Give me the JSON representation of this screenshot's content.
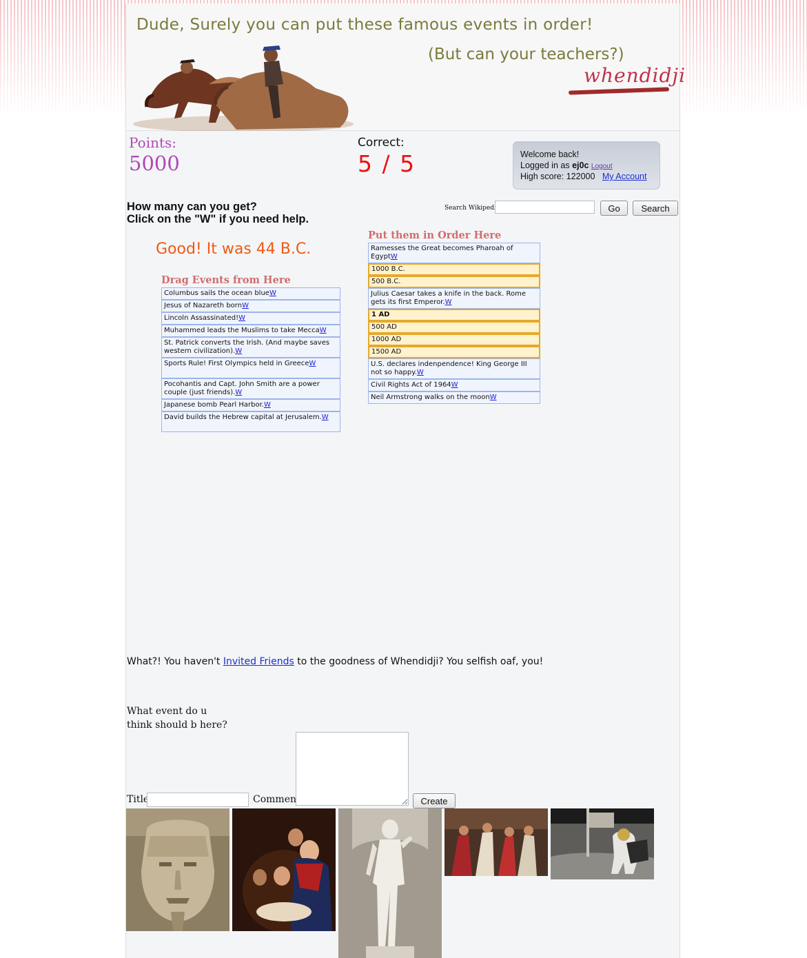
{
  "header": {
    "tagline": "Dude, Surely you can put these famous events in order!",
    "subtagline": "(But can your teachers?)",
    "logo": "whendidji"
  },
  "score": {
    "points_label": "Points:",
    "points_value": "5000",
    "correct_label": "Correct:",
    "correct_value": "5 / 5"
  },
  "account": {
    "welcome": "Welcome back!",
    "logged_in_prefix": "Logged in as",
    "username": "ej0c",
    "logout": "Logout",
    "high_score_label": "High score:",
    "high_score": "122000",
    "my_account": "My Account"
  },
  "prompt": {
    "line1": "How many can you get?",
    "line2": "Click on the \"W\" if you need help."
  },
  "search": {
    "label": "Search Wikipedia",
    "value": "",
    "go": "Go",
    "search": "Search"
  },
  "feedback": "Good! It was 44 B.C.",
  "drag_list": {
    "title": "Drag Events from Here",
    "items": [
      {
        "text": "Columbus sails the ocean blue",
        "w": "W"
      },
      {
        "text": "Jesus of Nazareth born",
        "w": "W"
      },
      {
        "text": "Lincoln Assassinated!",
        "w": "W"
      },
      {
        "text": "Muhammed leads the Muslims to take Mecca",
        "w": "W"
      },
      {
        "text": "St. Patrick converts the Irish. (And maybe saves western civilization).",
        "w": "W"
      },
      {
        "text": "Sports Rule! First Olympics held in Greece",
        "w": "W"
      },
      {
        "text": "Pocohantis and Capt. John Smith are a power couple (just friends).",
        "w": "W"
      },
      {
        "text": "Japanese bomb Pearl Harbor.",
        "w": "W"
      },
      {
        "text": "David builds the Hebrew capital at Jerusalem.",
        "w": "W"
      }
    ]
  },
  "order_list": {
    "title": "Put them in Order Here",
    "items": [
      {
        "text": "Ramesses the Great becomes Pharoah of Egypt",
        "w": "W",
        "kind": "event"
      },
      {
        "text": "1000 B.C.",
        "w": "",
        "kind": "slot"
      },
      {
        "text": "500 B.C.",
        "w": "",
        "kind": "slot"
      },
      {
        "text": "Julius Caesar takes a knife in the back. Rome gets its first Emperor.",
        "w": "W",
        "kind": "event"
      },
      {
        "text": "1 AD",
        "w": "",
        "kind": "slot-current"
      },
      {
        "text": "500 AD",
        "w": "",
        "kind": "slot"
      },
      {
        "text": "1000 AD",
        "w": "",
        "kind": "slot"
      },
      {
        "text": "1500 AD",
        "w": "",
        "kind": "slot"
      },
      {
        "text": "U.S. declares indenpendence! King George III not so happy.",
        "w": "W",
        "kind": "event"
      },
      {
        "text": "Civil Rights Act of 1964",
        "w": "W",
        "kind": "event"
      },
      {
        "text": "Neil Armstrong walks on the moon",
        "w": "W",
        "kind": "event"
      }
    ]
  },
  "invite": {
    "before": "What?! You haven't ",
    "link": "Invited Friends",
    "after": " to the goodness of Whendidji? You selfish oaf, you!"
  },
  "suggest": {
    "question": "What event do u think should b here?",
    "title_label": "Title",
    "title_value": "",
    "comment_label": "Comment",
    "comment_value": "",
    "create": "Create"
  },
  "thumbnails": [
    {
      "name": "ramesses-statue-image"
    },
    {
      "name": "nativity-painting-image"
    },
    {
      "name": "david-statue-image"
    },
    {
      "name": "caesar-assassination-painting-image"
    },
    {
      "name": "moon-landing-image"
    }
  ],
  "colors": {
    "points": "#b048b8",
    "correct": "#ee1111",
    "feedback": "#f05a14",
    "list_title": "#cf6e6e",
    "slot_border": "#e5a92c",
    "item_border": "#9cb4ec"
  }
}
